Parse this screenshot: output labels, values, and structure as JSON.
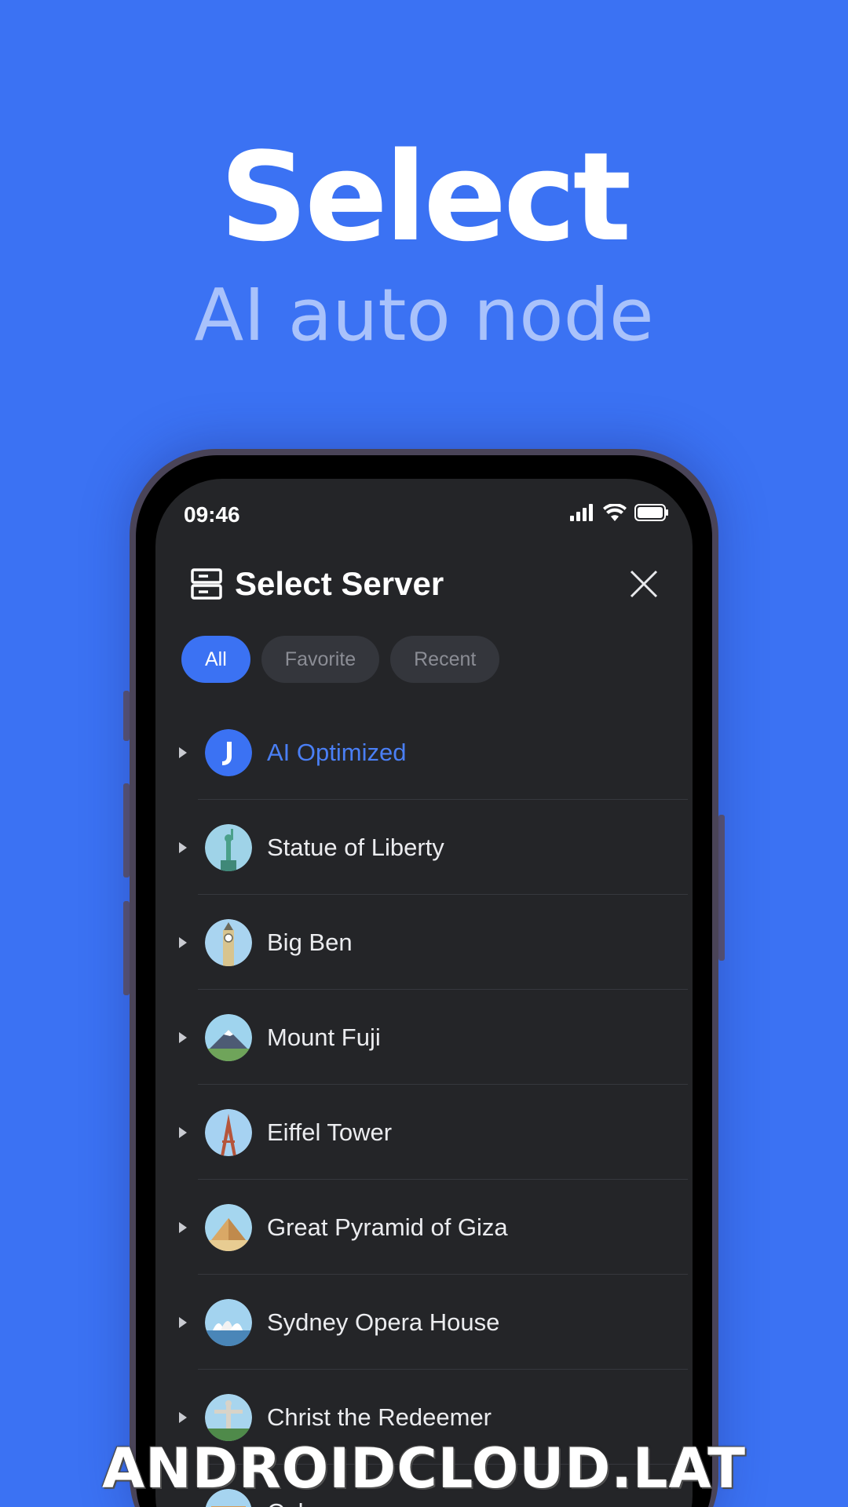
{
  "hero": {
    "headline": "Select",
    "subline": "AI auto node"
  },
  "status_bar": {
    "time": "09:46"
  },
  "header": {
    "title": "Select Server"
  },
  "tabs": [
    {
      "label": "All",
      "active": true
    },
    {
      "label": "Favorite",
      "active": false
    },
    {
      "label": "Recent",
      "active": false
    }
  ],
  "servers": [
    {
      "name": "AI Optimized",
      "icon": "ai-logo-icon",
      "highlight": true
    },
    {
      "name": "Statue of Liberty",
      "icon": "statue-of-liberty-icon"
    },
    {
      "name": "Big Ben",
      "icon": "big-ben-icon"
    },
    {
      "name": "Mount Fuji",
      "icon": "mount-fuji-icon"
    },
    {
      "name": "Eiffel Tower",
      "icon": "eiffel-tower-icon"
    },
    {
      "name": "Great Pyramid of Giza",
      "icon": "pyramid-icon"
    },
    {
      "name": "Sydney Opera House",
      "icon": "opera-house-icon"
    },
    {
      "name": "Christ the Redeemer",
      "icon": "christ-redeemer-icon"
    },
    {
      "name": "Colosseum",
      "icon": "colosseum-icon"
    }
  ],
  "watermark": "ANDROIDCLOUD.LAT",
  "colors": {
    "background": "#3b72f3",
    "accent": "#4a7ff5",
    "screen": "#242528"
  }
}
